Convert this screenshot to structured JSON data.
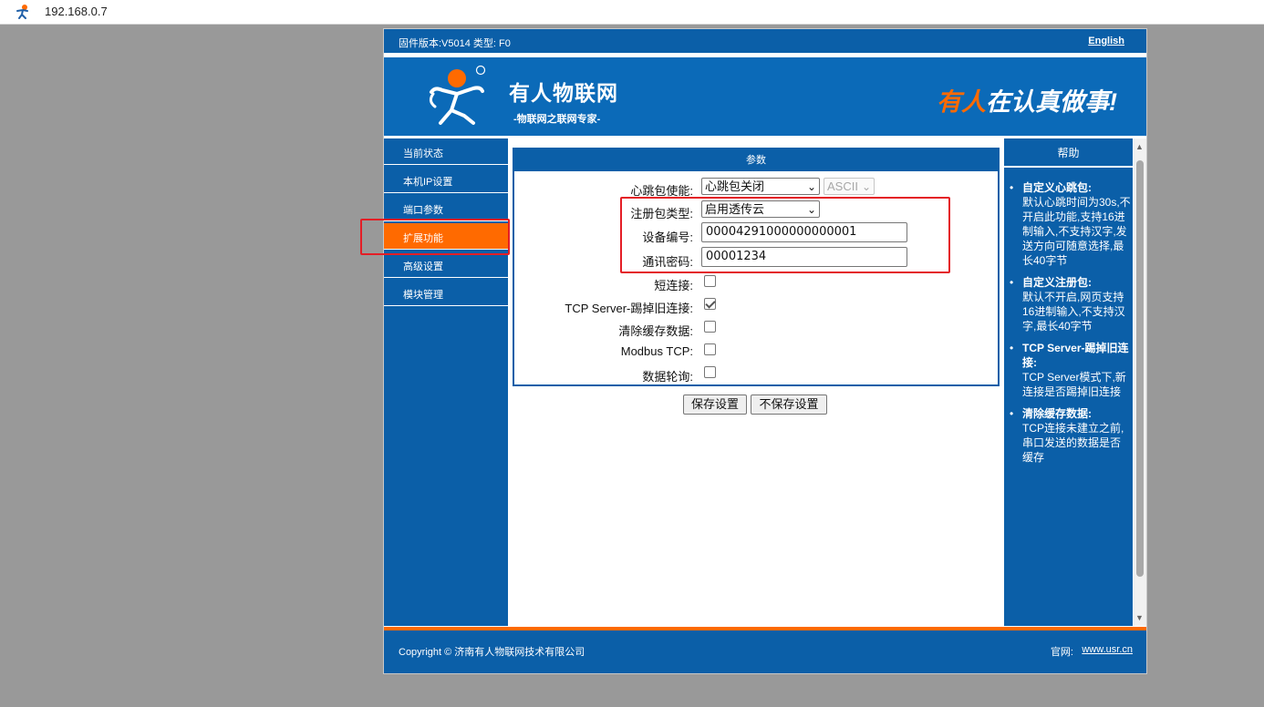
{
  "browser": {
    "url": "192.168.0.7",
    "favicon": "usr-logo-icon"
  },
  "topbar": {
    "firmware": "固件版本:V5014 类型: F0",
    "language_link": "English"
  },
  "banner": {
    "brand": "有人物联网",
    "brand_sub": "-物联网之联网专家-",
    "slogan_highlight": "有人",
    "slogan_rest": "在认真做事!"
  },
  "sidebar": {
    "items": [
      {
        "label": "当前状态"
      },
      {
        "label": "本机IP设置"
      },
      {
        "label": "端口参数"
      },
      {
        "label": "扩展功能",
        "active": true
      },
      {
        "label": "高级设置"
      },
      {
        "label": "模块管理"
      }
    ]
  },
  "params": {
    "title": "参数",
    "heartbeat": {
      "label": "心跳包使能:",
      "value": "心跳包关闭",
      "format": "ASCII"
    },
    "register": {
      "label": "注册包类型:",
      "value": "启用透传云"
    },
    "device_id": {
      "label": "设备编号:",
      "value": "00004291000000000001"
    },
    "password": {
      "label": "通讯密码:",
      "value": "00001234"
    },
    "short_conn": {
      "label": "短连接:",
      "checked": false
    },
    "tcp_kick": {
      "label": "TCP Server-踢掉旧连接:",
      "checked": true
    },
    "clear_cache": {
      "label": "清除缓存数据:",
      "checked": false
    },
    "modbus_tcp": {
      "label": "Modbus TCP:",
      "checked": false
    },
    "polling": {
      "label": "数据轮询:",
      "checked": false
    }
  },
  "buttons": {
    "save": "保存设置",
    "no_save": "不保存设置"
  },
  "help": {
    "title": "帮助",
    "items": [
      {
        "title": "自定义心跳包:",
        "body": "默认心跳时间为30s,不开启此功能,支持16进制输入,不支持汉字,发送方向可随意选择,最长40字节"
      },
      {
        "title": "自定义注册包:",
        "body": "默认不开启,网页支持16进制输入,不支持汉字,最长40字节"
      },
      {
        "title": "TCP Server-踢掉旧连接:",
        "body": "TCP Server模式下,新连接是否踢掉旧连接"
      },
      {
        "title": "清除缓存数据:",
        "body": "TCP连接未建立之前,串口发送的数据是否缓存"
      }
    ]
  },
  "footer": {
    "copyright": "Copyright © 济南有人物联网技术有限公司",
    "site_label": "官网:",
    "site_link": "www.usr.cn"
  },
  "colors": {
    "primary": "#0b5fa8",
    "accent": "#ff6a00",
    "highlight": "#e41e26"
  }
}
